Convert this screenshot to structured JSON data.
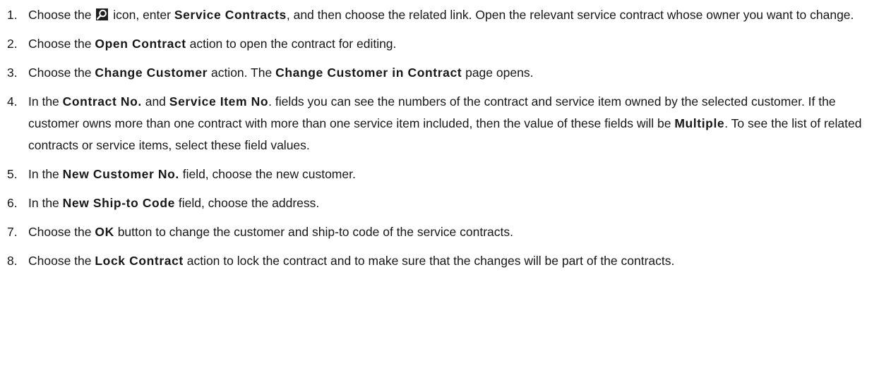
{
  "steps": [
    {
      "number": "1.",
      "parts": [
        {
          "t": "text",
          "v": "Choose the "
        },
        {
          "t": "icon",
          "name": "search-icon"
        },
        {
          "t": "text",
          "v": " icon, enter "
        },
        {
          "t": "ui",
          "v": "Service Contracts"
        },
        {
          "t": "text",
          "v": ", and then choose the related link. Open the relevant service contract whose owner you want to change."
        }
      ]
    },
    {
      "number": "2.",
      "parts": [
        {
          "t": "text",
          "v": "Choose the "
        },
        {
          "t": "ui",
          "v": "Open Contract"
        },
        {
          "t": "text",
          "v": " action to open the contract for editing."
        }
      ]
    },
    {
      "number": "3.",
      "parts": [
        {
          "t": "text",
          "v": "Choose the "
        },
        {
          "t": "ui",
          "v": "Change Customer"
        },
        {
          "t": "text",
          "v": " action. The "
        },
        {
          "t": "ui",
          "v": "Change Customer in Contract"
        },
        {
          "t": "text",
          "v": " page opens."
        }
      ]
    },
    {
      "number": "4.",
      "parts": [
        {
          "t": "text",
          "v": "In the "
        },
        {
          "t": "ui",
          "v": "Contract No."
        },
        {
          "t": "text",
          "v": " and "
        },
        {
          "t": "ui",
          "v": "Service Item No"
        },
        {
          "t": "text",
          "v": ". fields you can see the numbers of the contract and service item owned by the selected customer. If the customer owns more than one contract with more than one service item included, then the value of these fields will be "
        },
        {
          "t": "ui",
          "v": "Multiple"
        },
        {
          "t": "text",
          "v": ". To see the list of related contracts or service items, select these field values."
        }
      ]
    },
    {
      "number": "5.",
      "parts": [
        {
          "t": "text",
          "v": "In the "
        },
        {
          "t": "ui",
          "v": "New Customer No."
        },
        {
          "t": "text",
          "v": " field, choose the new customer."
        }
      ]
    },
    {
      "number": "6.",
      "parts": [
        {
          "t": "text",
          "v": "In the "
        },
        {
          "t": "ui",
          "v": "New Ship-to Code"
        },
        {
          "t": "text",
          "v": " field, choose the address."
        }
      ]
    },
    {
      "number": "7.",
      "parts": [
        {
          "t": "text",
          "v": "Choose the "
        },
        {
          "t": "ui",
          "v": "OK"
        },
        {
          "t": "text",
          "v": " button to change the customer and ship-to code of the service contracts."
        }
      ]
    },
    {
      "number": "8.",
      "parts": [
        {
          "t": "text",
          "v": "Choose the "
        },
        {
          "t": "ui",
          "v": "Lock Contract"
        },
        {
          "t": "text",
          "v": " action to lock the contract and to make sure that the changes will be part of the contracts."
        }
      ]
    }
  ]
}
